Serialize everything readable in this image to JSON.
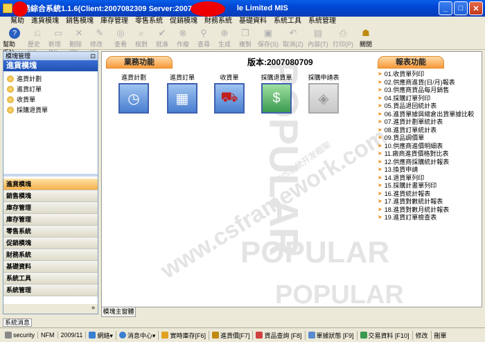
{
  "window": {
    "title": "業務綜合系統1.1.6(Client:2007082309  Server:20070601) - ",
    "title_suffix": "le Limited MIS",
    "buttons": {
      "minimize": "_",
      "maximize": "□",
      "close": "✕"
    }
  },
  "menu": [
    "幫助",
    "進貨模塊",
    "銷售模塊",
    "庫存管理",
    "零售系統",
    "促銷模塊",
    "財務系統",
    "基礎資料",
    "系統工具",
    "系統管理"
  ],
  "toolbar": [
    {
      "label": "幫助(F1)",
      "icon": "help-icon",
      "enabled": true
    },
    {
      "label": "歷史(H)",
      "icon": "history-icon",
      "enabled": false
    },
    {
      "label": "新增(N)",
      "icon": "new-icon",
      "enabled": false
    },
    {
      "label": "刪除(D)",
      "icon": "delete-icon",
      "enabled": false
    },
    {
      "label": "修改(E)",
      "icon": "edit-icon",
      "enabled": false
    },
    {
      "label": "查看",
      "icon": "view-icon",
      "enabled": false
    },
    {
      "label": "核對",
      "icon": "check-icon",
      "enabled": false
    },
    {
      "label": "批准",
      "icon": "approve-icon",
      "enabled": false
    },
    {
      "label": "作廢",
      "icon": "void-icon",
      "enabled": false
    },
    {
      "label": "查尋",
      "icon": "query-icon",
      "enabled": false
    },
    {
      "label": "生成",
      "icon": "generate-icon",
      "enabled": false
    },
    {
      "label": "複製",
      "icon": "copy-icon",
      "enabled": false
    },
    {
      "label": "保存(S)",
      "icon": "save-icon",
      "enabled": false
    },
    {
      "label": "取消(Z)",
      "icon": "cancel-icon",
      "enabled": false
    },
    {
      "label": "內容(T)",
      "icon": "content-icon",
      "enabled": false
    },
    {
      "label": "打印(P)",
      "icon": "print-icon",
      "enabled": false
    },
    {
      "label": "關閉",
      "icon": "close-icon",
      "enabled": true
    }
  ],
  "sidebar": {
    "header": "模塊管理",
    "pin": "⊡",
    "title": "進貨模塊",
    "items": [
      "進貨計劃",
      "進貨訂單",
      "收貨單",
      "採購退貨單"
    ],
    "categories": [
      "進貨模塊",
      "銷售模塊",
      "庫存管理",
      "庫存管理",
      "零售系統",
      "促銷模塊",
      "財務系統",
      "基礎資料",
      "系統工具",
      "系統管理"
    ],
    "active_category": "進貨模塊",
    "more": "»"
  },
  "main": {
    "section_left": "業務功能",
    "version": "版本:2007080709",
    "section_right": "報表功能",
    "features": [
      {
        "label": "進貨計劃",
        "icon": "plan-clock-icon",
        "enabled": true
      },
      {
        "label": "進貨訂單",
        "icon": "order-icon",
        "enabled": true
      },
      {
        "label": "收貨單",
        "icon": "cart-icon",
        "enabled": true
      },
      {
        "label": "採購退貨單",
        "icon": "return-money-icon",
        "enabled": true
      },
      {
        "label": "採購申請表",
        "icon": "request-icon",
        "enabled": false
      }
    ],
    "reports": [
      "01.收貨單列印",
      "02.供應商進貨(日/月)報表",
      "03.供應商貨品每月銷售",
      "04.採購訂單列印",
      "05.貨品退回統計表",
      "06.進貨單據與總倉出貨單據比較",
      "07.進貨計劃單統計表",
      "08.進貨訂單統計表",
      "09.貨品調價單",
      "10.供應商進價明細表",
      "11.廠商進貨價格對比表",
      "12.供應商採購統計報表",
      "13.換貨申請",
      "14.退貨單列印",
      "15.採購計畫單列印",
      "16.進貨統計報表",
      "17.進貨對數統計報表",
      "18.進貨對數月統計報表",
      "19.進貨訂單檢查表"
    ],
    "tab": "模塊主窗體",
    "watermarks": [
      "POPULAR",
      "C/S系統开发框架",
      "www.csframework.com",
      "POPULAR",
      "POPULAR"
    ]
  },
  "system_message": "系統消息",
  "statusbar": [
    "security",
    "NFM",
    "2009/11",
    "網絡▾",
    "消息中心▾",
    "實時庫存[F6]",
    "進貨價[F7]",
    "貨品查詢 [F8]",
    "單據狀態 [F9]",
    "交易資料 [F10]",
    "修改",
    "刪單"
  ]
}
